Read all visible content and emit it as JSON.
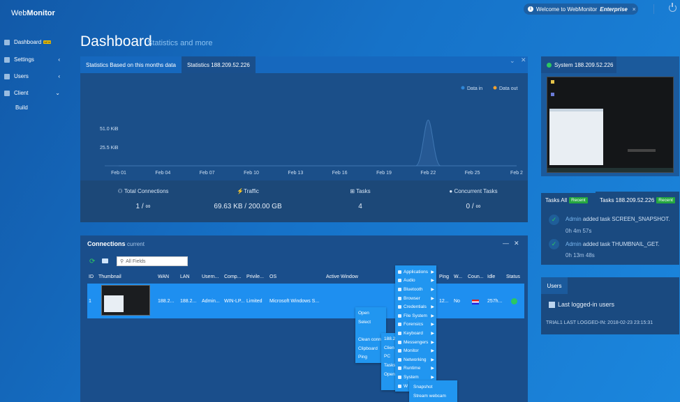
{
  "brand": {
    "prefix": "Web",
    "bold": "Monitor"
  },
  "topbar": {
    "welcome_text": "Welcome to WebMonitor",
    "welcome_bold": "Enterprise",
    "close": "×"
  },
  "sidebar": {
    "items": [
      {
        "label": "Dashboard",
        "badge": "NEW",
        "icon": "home-icon"
      },
      {
        "label": "Settings",
        "icon": "pencil-icon",
        "chevron": "‹"
      },
      {
        "label": "Users",
        "icon": "users-icon",
        "chevron": "‹"
      },
      {
        "label": "Client",
        "icon": "folder-icon",
        "chevron": "⌄"
      }
    ],
    "subitem": "Build"
  },
  "page": {
    "title": "Dashboard",
    "subtitle": "Statistics and more"
  },
  "stats_panel": {
    "tabs": [
      "Statistics Based on this months data",
      "Statistics 188.209.52.226"
    ],
    "legend": [
      "Data in",
      "Data out"
    ],
    "yticks": [
      "51.0 KiB",
      "25.5 KiB"
    ],
    "xticks": [
      "Feb 01",
      "Feb 04",
      "Feb 07",
      "Feb 10",
      "Feb 13",
      "Feb 16",
      "Feb 19",
      "Feb 22",
      "Feb 25",
      "Feb 2"
    ],
    "summary": [
      {
        "label": "Total Connections",
        "value": "1 / ∞"
      },
      {
        "label": "Traffic",
        "value": "69.63 KB / 200.00 GB"
      },
      {
        "label": "Tasks",
        "value": "4"
      },
      {
        "label": "Concurrent Tasks",
        "value": "0 / ∞"
      }
    ]
  },
  "chart_data": {
    "type": "area",
    "x": [
      "Feb 01",
      "Feb 04",
      "Feb 07",
      "Feb 10",
      "Feb 13",
      "Feb 16",
      "Feb 19",
      "Feb 22",
      "Feb 25",
      "Feb 2"
    ],
    "series": [
      {
        "name": "Data in",
        "values": [
          0,
          0,
          0,
          0,
          0,
          0,
          0,
          0,
          0,
          0
        ]
      },
      {
        "name": "Data out",
        "values": [
          0,
          0,
          0,
          0,
          0,
          0,
          0,
          62,
          0,
          0
        ]
      }
    ],
    "yticks": [
      "51.0 KiB",
      "25.5 KiB"
    ],
    "legend": "top-right",
    "colors": {
      "Data in": "#2f86d6",
      "Data out": "#f0a030"
    }
  },
  "connections": {
    "title": "Connections",
    "subtitle": "current",
    "search_placeholder": "All Fields",
    "columns": [
      "ID",
      "Thumbnail",
      "WAN",
      "LAN",
      "Usern...",
      "Comp...",
      "Privile...",
      "OS",
      "Active Window",
      "Ping",
      "W...",
      "Coun...",
      "Idle",
      "Status"
    ],
    "row": [
      "1",
      "",
      "188.2...",
      "188.2...",
      "Admin...",
      "WIN-LP...",
      "Limited",
      "Microsoft Windows S...",
      "",
      "12...",
      "No",
      "",
      "257h...",
      ""
    ]
  },
  "context_menu_main": [
    "Open",
    "Select",
    "",
    "Clean conn",
    "Clipboard",
    "Ping"
  ],
  "context_menu_sub": [
    "188.2",
    "Clien",
    "PC",
    "Tasks",
    "Open"
  ],
  "context_menu_apps": [
    "Applications",
    "Audio",
    "Bluetooth",
    "Browser",
    "Credentials",
    "File System",
    "Forensics",
    "Keyboard",
    "Messengers",
    "Monitor",
    "Networking",
    "Runtime",
    "System",
    "W"
  ],
  "context_menu_leaf": [
    "Snapshot",
    "Stream webcam"
  ],
  "system_panel": {
    "label": "System 188.209.52.226"
  },
  "tasks_panel": {
    "tabs": [
      {
        "label": "Tasks All",
        "badge": "Recent"
      },
      {
        "label": "Tasks 188.209.52.226",
        "badge": "Recent"
      }
    ],
    "entries": [
      {
        "user": "Admin",
        "text": "added task",
        "task": "SCREEN_SNAPSHOT.",
        "time": "0h 4m 57s"
      },
      {
        "user": "Admin",
        "text": "added task",
        "task": "THUMBNAIL_GET.",
        "time": "0h 13m 48s"
      }
    ]
  },
  "users_panel": {
    "tab": "Users",
    "heading": "Last logged-in users",
    "line": "TRIAL1  LAST LOGGED-IN: 2018-02-23 23:15:31"
  }
}
